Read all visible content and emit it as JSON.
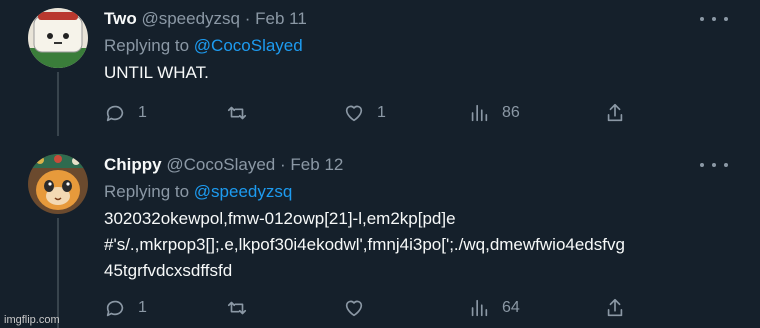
{
  "tweets": [
    {
      "display_name": "Two",
      "handle": "@speedyzsq",
      "date": "Feb 11",
      "replying_to_label": "Replying to",
      "replying_to_handle": "@CocoSlayed",
      "text_lines": [
        "UNTIL WHAT."
      ],
      "stats": {
        "replies": "1",
        "retweets": "",
        "likes": "1",
        "views": "86"
      }
    },
    {
      "display_name": "Chippy",
      "handle": "@CocoSlayed",
      "date": "Feb 12",
      "replying_to_label": "Replying to",
      "replying_to_handle": "@speedyzsq",
      "text_lines": [
        "302032okewpol,fmw-012owp[21]-l,em2kp[pd]e",
        "#'s/.,mkrpop3[];.e,lkpof30i4ekodwl',fmnj4i3po[';./wq,dmewfwio4edsfvg",
        "45tgrfvdcxsdffsfd"
      ],
      "stats": {
        "replies": "1",
        "retweets": "",
        "likes": "",
        "views": "64"
      }
    }
  ],
  "separator": "·",
  "icons": [
    "reply-icon",
    "retweet-icon",
    "like-icon",
    "views-icon",
    "share-icon",
    "more-icon"
  ],
  "colors": {
    "background": "#15202b",
    "text": "#f7f9f9",
    "muted": "#8b98a5",
    "accent": "#1d9bf0",
    "thread_line": "#38444d"
  },
  "watermark": "imgflip.com"
}
